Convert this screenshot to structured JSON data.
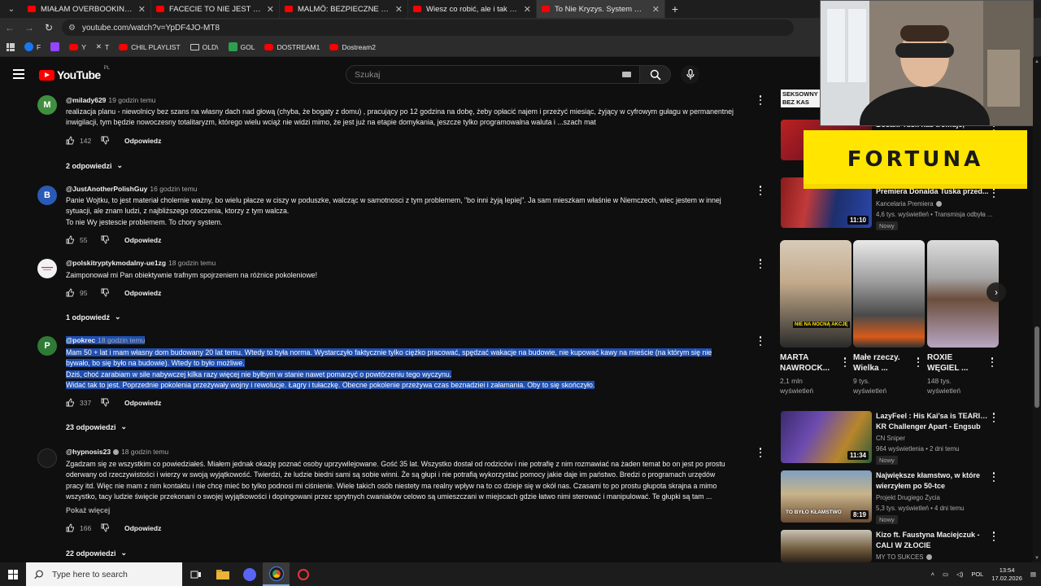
{
  "browser": {
    "tabs": [
      {
        "title": "MIAŁAM OVERBOOKING I NIE ...",
        "active": false
      },
      {
        "title": "FACECIE TO NIE JEST PRZYPAD...",
        "active": false
      },
      {
        "title": "MALMÖ: BEZPIECZNE GETTO ...",
        "active": false
      },
      {
        "title": "Wiesz co robić, ale i tak Ci nie w...",
        "active": false
      },
      {
        "title": "To Nie Kryzys. System HODUJE...",
        "active": true
      }
    ],
    "url": "youtube.com/watch?v=YpDF4JO-MT8",
    "bookmarks": [
      {
        "label": "F",
        "icon_color": "#1877f2"
      },
      {
        "label": "",
        "icon_color": "#9146ff"
      },
      {
        "label": "Y",
        "icon_color": "#ff0000"
      },
      {
        "label": "T",
        "icon_color": "#ffffff"
      },
      {
        "label": "CHIL PLAYLIST",
        "icon_color": "#ff0000"
      },
      {
        "label": "OLD\\",
        "icon_color": "folder"
      },
      {
        "label": "GOL",
        "icon_color": "#2e9e4f"
      },
      {
        "label": "DOSTREAM1",
        "icon_color": "#ff0000"
      },
      {
        "label": "Dostream2",
        "icon_color": "#ff0000"
      }
    ]
  },
  "youtube": {
    "logo_text": "YouTube",
    "region": "PL",
    "search_placeholder": "Szukaj"
  },
  "comments": [
    {
      "author": "@milady629",
      "time": "19 godzin temu",
      "avatar_letter": "M",
      "avatar_color": "#3f8f3f",
      "lines": [
        "realizacja planu - niewolnicy bez szans na własny dach nad głową (chyba, że bogaty z domu) , pracujący po 12 godzina na dobę, żeby opłacić najem i przeżyć miesiąc, żyjący w cyfrowym gułagu w permanentnej",
        "inwigilacji, tym będzie nowoczesny totalitaryzm, którego wielu wciąż nie widzi mimo, że jest już na etapie domykania, jeszcze tylko programowalna waluta i ...szach mat"
      ],
      "likes": "142",
      "reply_label": "Odpowiedz",
      "replies": "2 odpowiedzi"
    },
    {
      "author": "@JustAnotherPolishGuy",
      "time": "16 godzin temu",
      "avatar_letter": "B",
      "avatar_color": "#2b5ab6",
      "lines": [
        "Panie Wojtku, to jest materiał cholernie ważny, bo wielu płacze w ciszy w poduszke, walcząc w samotnosci z tym problemem, \"bo inni żyją lepiej\". Ja sam mieszkam właśnie w Niemczech,  wiec jestem w innej",
        "sytuacji, ale znam ludzi, z najbliższego otoczenia, ktorzy z tym walcza.",
        "To nie Wy jestescie problemem. To chory system."
      ],
      "likes": "55",
      "reply_label": "Odpowiedz",
      "replies": ""
    },
    {
      "author": "@polskitryptykmodalny-ue1zg",
      "time": "18 godzin temu",
      "avatar_letter": "",
      "avatar_color": "#f2f2f2",
      "lines": [
        "Zaimponował mi Pan obiektywnie trafnym spojrzeniem na różnice pokoleniowe!"
      ],
      "likes": "95",
      "reply_label": "Odpowiedz",
      "replies": "1 odpowiedź"
    },
    {
      "author": "@pokrec",
      "time": "18 godzin temu",
      "avatar_letter": "P",
      "avatar_color": "#2f7a36",
      "lines": [
        "Mam 50 + lat i mam własny dom budowany 20 lat temu. Wtedy to była norma. Wystarczyło faktycznie tylko ciężko pracować, spędzać wakacje na budowie, nie kupować kawy na mieście (na którym się nie",
        "bywało, bo się było na budowie). Wtedy to było możliwe.",
        "Dziś, choć zarabiam w sile nabywczej kilka razy więcej nie byłbym w stanie nawet pomarzyć o powtórzeniu tego wyczynu.",
        "Widać tak to jest. Poprzednie pokolenia przeżywały wojny i rewolucje. Łagry i tułaczkę. Obecne pokolenie przeżywa czas beznadziei i załamania. Oby to się skończyło."
      ],
      "likes": "337",
      "reply_label": "Odpowiedz",
      "replies": "23 odpowiedzi",
      "selected": true
    },
    {
      "author": "@hypnosis23",
      "time": "18 godzin temu",
      "avatar_letter": "",
      "avatar_color": "#1a1a1a",
      "verified": true,
      "lines": [
        "Zgadzam się ze wszystkim co powiedziałeś. Miałem jednak okazję poznać osoby uprzywilejowane. Gość 35 lat. Wszystko dostał od rodziców i nie potrafię z nim rozmawiać na żaden temat bo on jest po prostu",
        "oderwany od rzeczywistości i wierzy w swoją wyjątkowość. Twierdzi, że ludzie biedni sami są sobie winni. Że są głupi i nie potrafią wykorzystać pomocy jakie daje im państwo. Bredzi o programach urzędów",
        "pracy itd. Więc nie mam z nim kontaktu i nie chcę mieć bo tylko podnosi mi ciśnienie. Wiele takich osób niestety ma realny wpływ na to co dzieje się w okół nas. Czasami to po prostu głupota skrajna a mimo",
        "wszystko, tacy ludzie święcie przekonani o swojej wyjątkowości i dopingowani przez sprytnych cwaniaków celowo są umieszczani w miejscach gdzie łatwo nimi sterować i manipulować. Te głupki są tam ..."
      ],
      "more_label": "Pokaż więcej",
      "likes": "166",
      "reply_label": "Odpowiedz",
      "replies": "22 odpowiedzi"
    }
  ],
  "sidebar": {
    "overlay_text": "SEKSOWNY BEZ KAS",
    "fortuna_text": "FORTUNA",
    "top_video": {
      "title_line1": "Bosak: Tusk nas tromuje,",
      "title_line2": "",
      "duration": "",
      "channel": "",
      "meta": ""
    },
    "video1": {
      "title_line1": "Premiera Donalda Tuska przed...",
      "channel": "Kancelaria Premiera",
      "meta": "4,6 tys. wyświetleń • Transmisja odbyła ...",
      "badge": "Nowy",
      "duration": "11:10"
    },
    "shorts": [
      {
        "title_line1": "MARTA",
        "title_line2": "NAWROCK...",
        "views_line1": "2,1 mln",
        "views_line2": "wyświetleń",
        "thumb_text": "NIE NA NOCNĄ AKCJĘ"
      },
      {
        "title_line1": "Małe rzeczy.",
        "title_line2": "Wielka ...",
        "views_line1": "9 tys.",
        "views_line2": "wyświetleń",
        "thumb_text": ""
      },
      {
        "title_line1": "ROXIE",
        "title_line2": "WĘGIEL ...",
        "views_line1": "148 tys.",
        "views_line2": "wyświetleń",
        "thumb_text": ""
      }
    ],
    "videos": [
      {
        "title_line1": "LazyFeel : His Kai'sa is TEARING",
        "title_line2": "KR Challenger Apart - Engsub",
        "channel": "CN Sniper",
        "meta": "964 wyświetlenia • 2 dni temu",
        "badge": "Nowy",
        "duration": "11:34"
      },
      {
        "title_line1": "Największe kłamstwo, w które",
        "title_line2": "wierzyłem po 50-tce",
        "channel": "Projekt Drugiego Życia",
        "meta": "5,3 tys. wyświetleń • 4 dni temu",
        "badge": "Nowy",
        "duration": "8:19",
        "thumb_text": "TO BYŁO KŁAMSTWO"
      },
      {
        "title_line1": "Kizo ft. Faustyna Maciejczuk -",
        "title_line2": "CALI W ZŁOCIE",
        "channel": "MY TO SUKCES",
        "meta": "",
        "badge": "",
        "duration": ""
      }
    ]
  },
  "taskbar": {
    "search_placeholder": "Type here to search",
    "language": "POL",
    "time": "13:54",
    "date": "17.02.2026"
  }
}
